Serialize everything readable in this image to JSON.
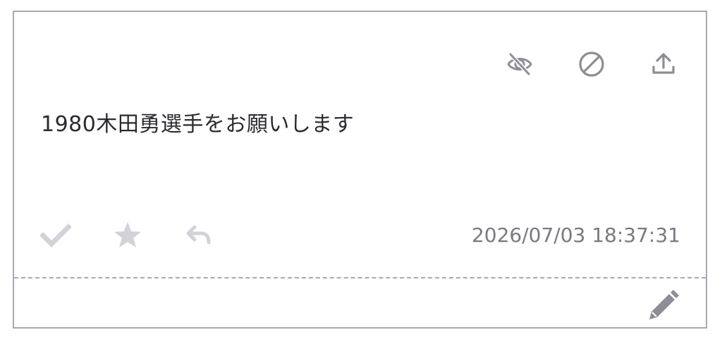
{
  "message": {
    "text": "1980木田勇選手をお願いします",
    "timestamp": "2026/07/03 18:37:31"
  },
  "icons": {
    "hide": "eye-slash-icon",
    "block": "ban-icon",
    "share": "upload-icon",
    "check": "check-icon",
    "favorite": "star-icon",
    "reply": "reply-icon",
    "edit": "pencil-icon"
  },
  "colors": {
    "text": "#2b2b2f",
    "muted_text": "#7a7983",
    "top_icon": "#8e8d96",
    "faint_icon": "#d3d2d8",
    "border": "#a9a8b2"
  }
}
